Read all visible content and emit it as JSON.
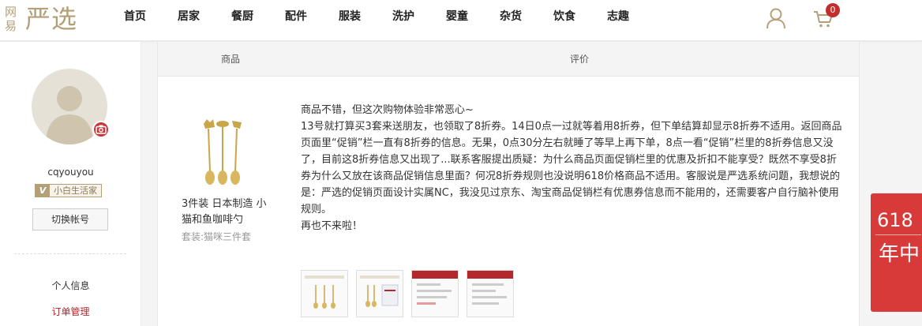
{
  "header": {
    "logo_small": "网易",
    "logo_big": "严选",
    "nav": [
      "首页",
      "居家",
      "餐厨",
      "配件",
      "服装",
      "洗护",
      "婴童",
      "杂货",
      "饮食",
      "志趣"
    ],
    "cart_count": "0",
    "accent": "#b4a078",
    "badge_color": "#c42d2d"
  },
  "sidebar": {
    "username": "cqyouyou",
    "level_badge": "V",
    "level_label": "小白生活家",
    "switch_button": "切换帐号",
    "links": [
      "个人信息",
      "订单管理"
    ]
  },
  "table": {
    "col_product": "商品",
    "col_review": "评价"
  },
  "product": {
    "name": "3件装 日本制造 小猫和鱼咖啡勺",
    "spec": "套装:猫咪三件套"
  },
  "review": {
    "lines": [
      "商品不错，但这次购物体验非常恶心~",
      "13号就打算买3套来送朋友，也领取了8折券。14日0点一过就等着用8折券，但下单结算却显示8折券不适用。返回商品页面里“促销”栏一直有8折券的信息。无果，0点30分左右就睡了等早上再下单，8点一看“促销”栏里的8折券信息又没了，目前这8折券信息又出现了...联系客服提出质疑：为什么商品页面促销栏里的优惠及折扣不能享受？既然不享受8折券为什么又放在该商品促销信息里面？何况8折券规则也没说明618价格商品不适用。客服说是严选系统问题，我想说的是：严选的促销页面设计实属NC，我没见过京东、淘宝商品促销栏有优惠券信息而不能用的，还需要客户自行脑补使用规则。",
      "再也不来啦！"
    ],
    "thumb_count": 4
  },
  "promo": {
    "number": "618",
    "text": "年中"
  }
}
